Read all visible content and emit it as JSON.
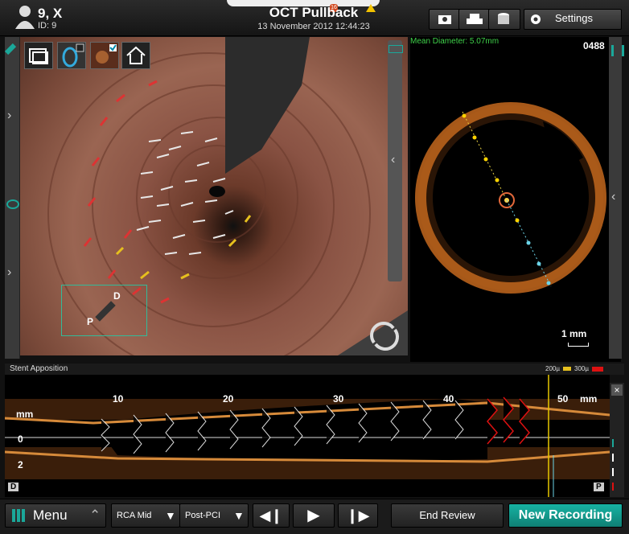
{
  "patient": {
    "name": "9, X",
    "id": "ID: 9"
  },
  "header": {
    "title": "OCT Pullback",
    "datetime": "13 November 2012 12:44:23",
    "notification_count": "16",
    "settings_label": "Settings"
  },
  "oct": {
    "mean_diameter": "Mean Diameter: 5.07mm",
    "frame_number": "0488",
    "scale_label": "1 mm"
  },
  "view3d": {
    "distal_label": "D",
    "proximal_label": "P"
  },
  "lview": {
    "title": "Stent Apposition",
    "legend": [
      "200µ",
      "300µ"
    ],
    "ticks": [
      "10",
      "20",
      "30",
      "40",
      "50"
    ],
    "unit": "mm",
    "y_unit": "mm",
    "y_ticks": [
      "0",
      "2"
    ],
    "distal": "D",
    "proximal": "P"
  },
  "bottom": {
    "menu_label": "Menu",
    "segment": "RCA Mid",
    "phase": "Post-PCI",
    "end_review": "End Review",
    "new_recording": "New Recording"
  },
  "colors": {
    "accent_teal": "#1aa89a",
    "diameter_green": "#3fd24a",
    "malapposed_red": "#d11"
  }
}
